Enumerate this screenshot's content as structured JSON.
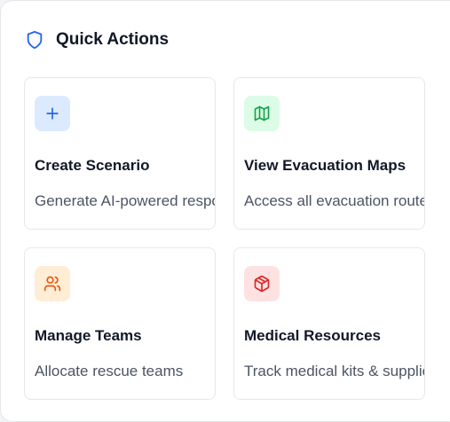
{
  "header": {
    "icon": "shield-icon",
    "title": "Quick Actions"
  },
  "colors": {
    "shield": "#2563eb",
    "blue_bg": "#dbeafe",
    "blue_fg": "#2563eb",
    "green_bg": "#dcfce7",
    "green_fg": "#16a34a",
    "orange_bg": "#ffedd5",
    "orange_fg": "#ea580c",
    "red_bg": "#fee2e2",
    "red_fg": "#dc2626"
  },
  "actions": [
    {
      "icon": "plus-icon",
      "title": "Create Scenario",
      "description": "Generate AI-powered response plans"
    },
    {
      "icon": "map-icon",
      "title": "View Evacuation Maps",
      "description": "Access all evacuation routes"
    },
    {
      "icon": "users-icon",
      "title": "Manage Teams",
      "description": "Allocate rescue teams"
    },
    {
      "icon": "package-icon",
      "title": "Medical Resources",
      "description": "Track medical kits & supplies"
    }
  ]
}
